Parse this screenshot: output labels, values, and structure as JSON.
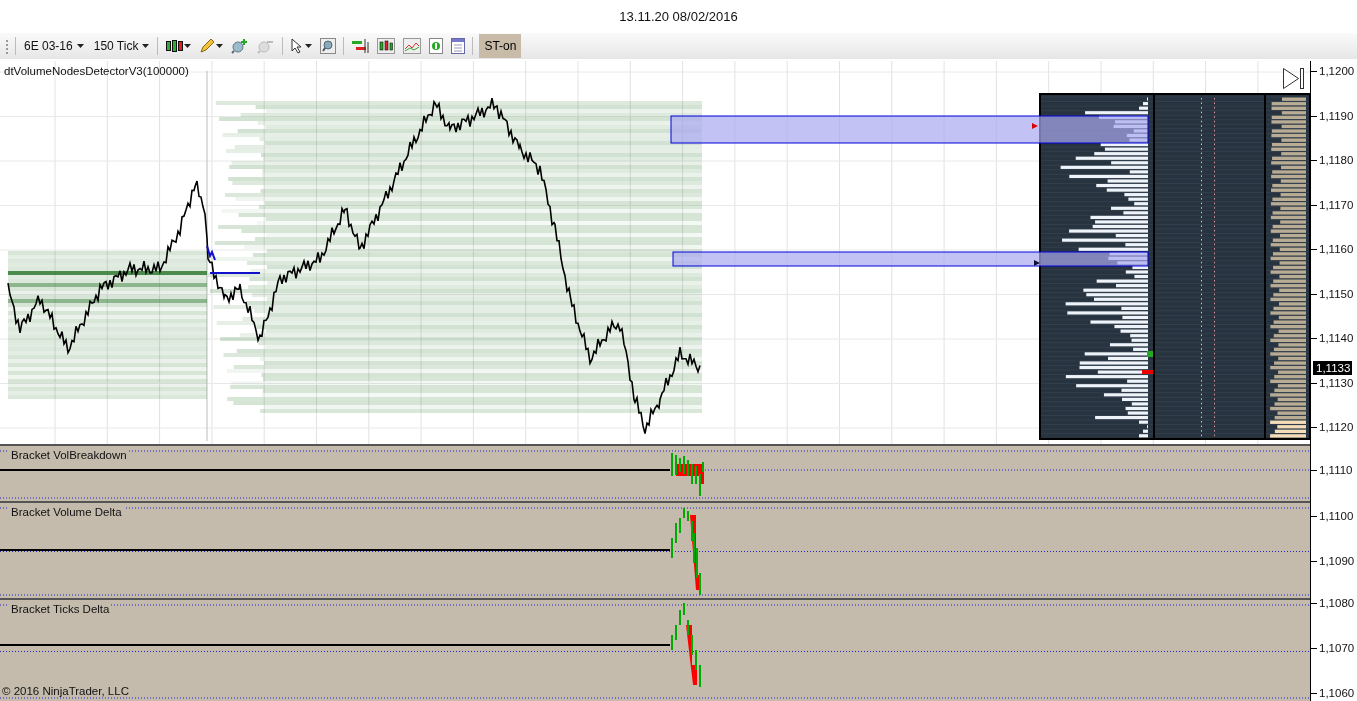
{
  "window": {
    "title": "13.11.20 08/02/2016"
  },
  "toolbar": {
    "instrument": "6E 03-16",
    "interval": "150 Tick",
    "st_button": {
      "label": "ST-on",
      "selected": true
    }
  },
  "price_panel": {
    "indicator_label": "dtVolumeNodesDetectorV3(100000)",
    "axis_labels": [
      "1,1200",
      "1,1190",
      "1,1180",
      "1,1170",
      "1,1160",
      "1,1150",
      "1,1140",
      "1,1130",
      "1,1120"
    ],
    "current_price": "1,1133"
  },
  "sub_panels": [
    {
      "title": "Bracket VolBreakdown",
      "axis_labels": [
        "1,1110"
      ]
    },
    {
      "title": "Bracket Volume Delta",
      "axis_labels": [
        "1,1100",
        "1,1090"
      ]
    },
    {
      "title": "Bracket Ticks Delta",
      "axis_labels": [
        "1,1080",
        "1,1070",
        "1,1060"
      ]
    }
  ],
  "copyright": "© 2016 NinjaTrader, LLC"
}
